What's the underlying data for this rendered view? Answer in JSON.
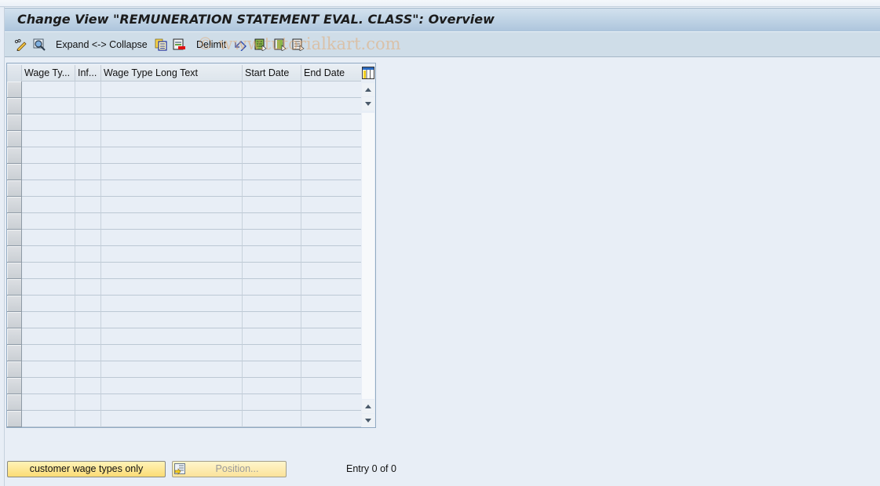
{
  "window": {
    "title": "Change View \"REMUNERATION STATEMENT EVAL. CLASS\": Overview"
  },
  "toolbar": {
    "items": [
      {
        "icon": "display-change-icon",
        "label": ""
      },
      {
        "icon": "find-icon",
        "label": ""
      },
      {
        "icon": "",
        "label": "Expand <-> Collapse"
      },
      {
        "icon": "copy-as-icon",
        "label": ""
      },
      {
        "icon": "delete-icon",
        "label": ""
      },
      {
        "icon": "",
        "label": "Delimit"
      },
      {
        "icon": "undo-change-icon",
        "label": ""
      },
      {
        "icon": "select-all-icon",
        "label": ""
      },
      {
        "icon": "select-block-icon",
        "label": ""
      },
      {
        "icon": "deselect-all-icon",
        "label": ""
      }
    ],
    "expand_collapse_label": "Expand <-> Collapse",
    "delimit_label": "Delimit"
  },
  "watermark": "© www.tutorialkart.com",
  "table": {
    "columns": [
      {
        "key": "wage_type",
        "label": "Wage Ty..."
      },
      {
        "key": "inf",
        "label": "Inf..."
      },
      {
        "key": "long_text",
        "label": "Wage Type Long Text"
      },
      {
        "key": "start_date",
        "label": "Start Date"
      },
      {
        "key": "end_date",
        "label": "End Date"
      }
    ],
    "rows": [
      {},
      {},
      {},
      {},
      {},
      {},
      {},
      {},
      {},
      {},
      {},
      {},
      {},
      {},
      {},
      {},
      {},
      {},
      {},
      {},
      {}
    ],
    "column_config_icon": "table-settings-icon"
  },
  "footer": {
    "customer_button_label": "customer wage types only",
    "position_button_label": "Position...",
    "entry_text": "Entry 0 of 0"
  },
  "colors": {
    "title_bar": "#adc5dc",
    "toolbar": "#cfdde8",
    "background": "#e8eef6",
    "button_yellow": "#fbdc75"
  }
}
